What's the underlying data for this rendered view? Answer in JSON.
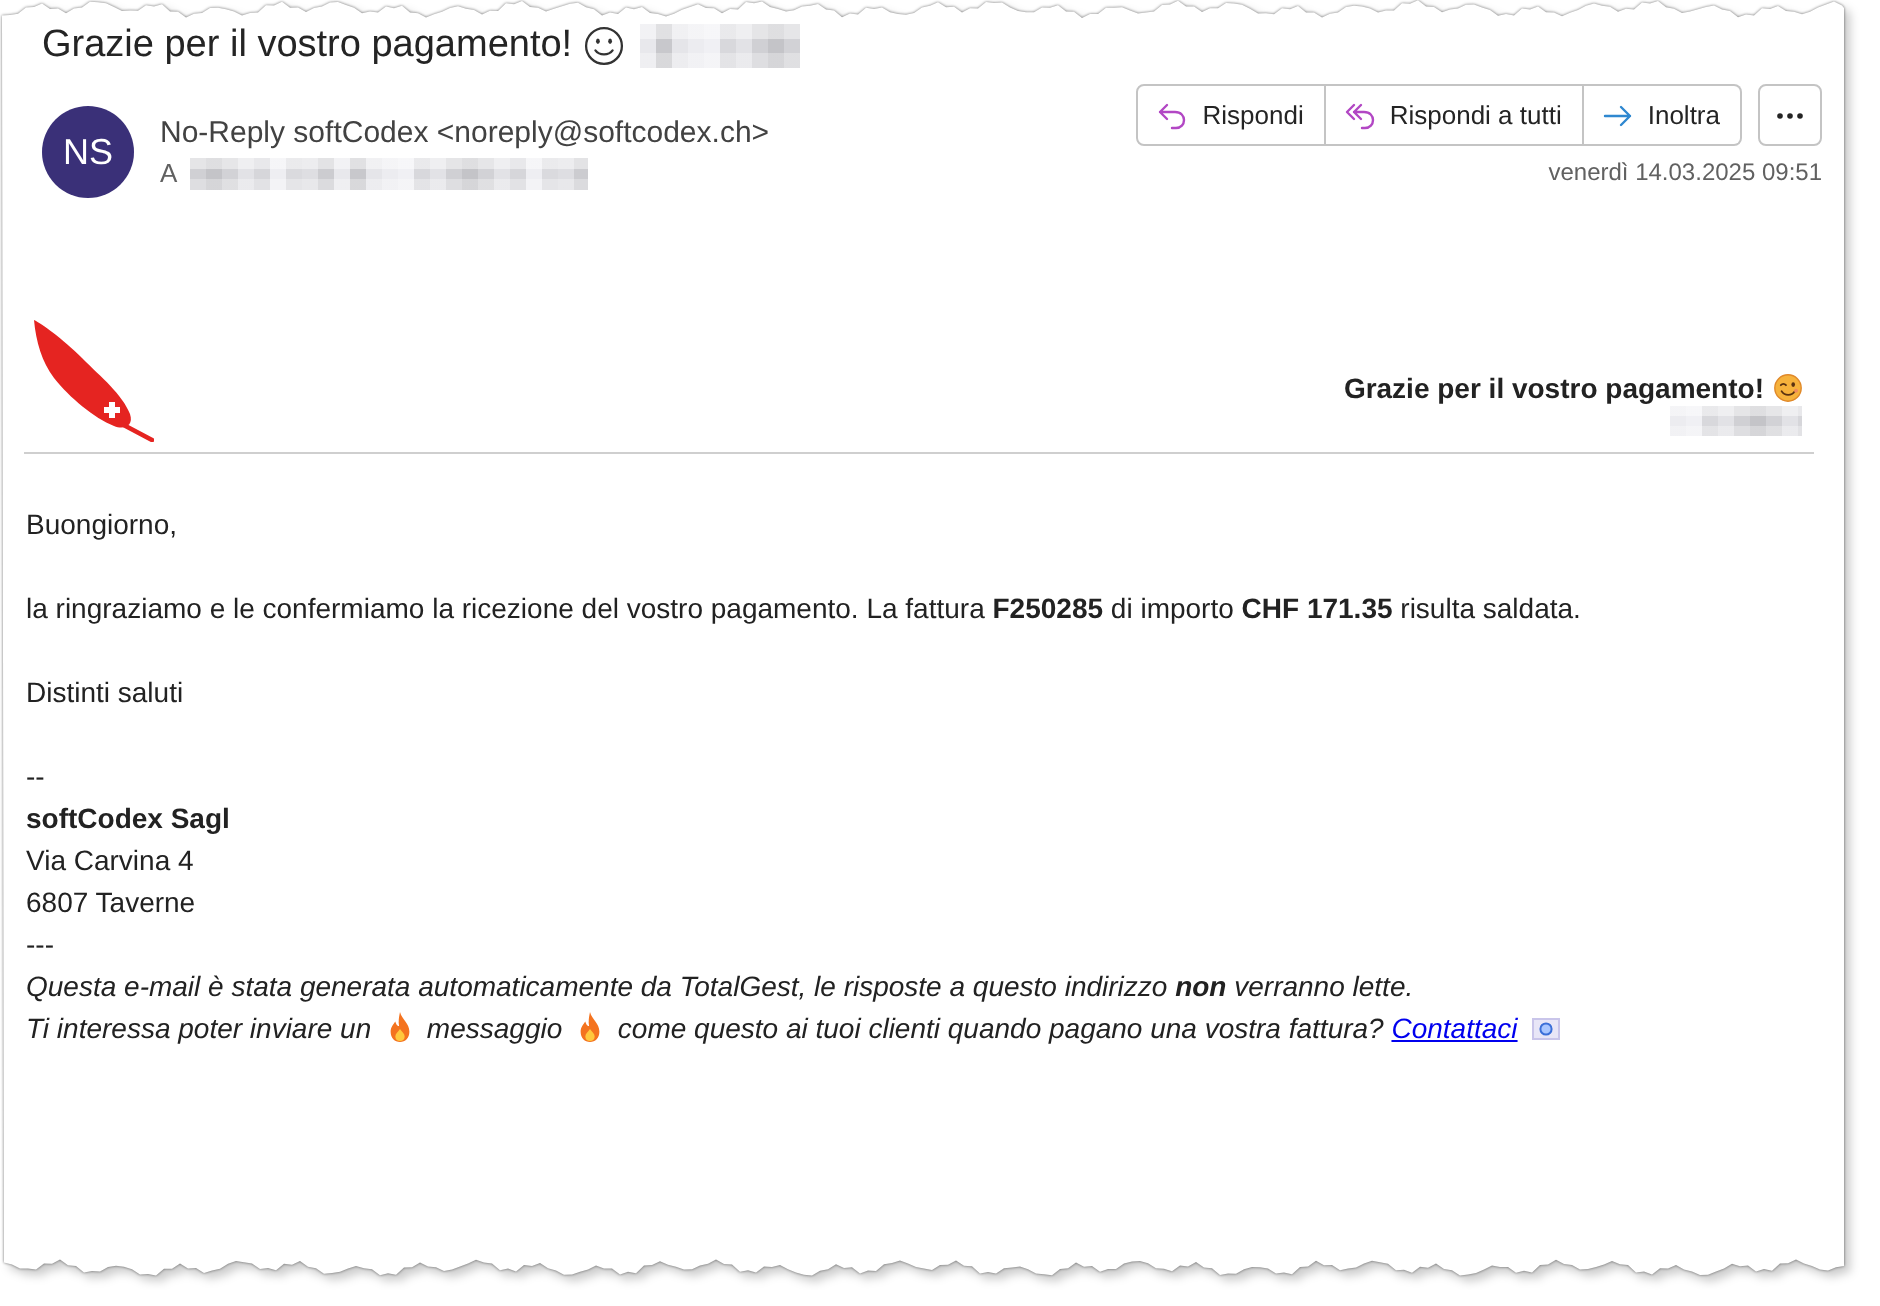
{
  "subject": {
    "text": "Grazie per il vostro pagamento!",
    "redacted_suffix": true
  },
  "sender": {
    "initials": "NS",
    "address": "No-Reply softCodex <noreply@softcodex.ch>"
  },
  "recipient": {
    "label": "A",
    "redacted": true
  },
  "actions": [
    {
      "kind": "reply",
      "label": "Rispondi"
    },
    {
      "kind": "reply_all",
      "label": "Rispondi a tutti"
    },
    {
      "kind": "forward",
      "label": "Inoltra"
    },
    {
      "kind": "more"
    }
  ],
  "sent_date": "venerdì 14.03.2025 09:51",
  "body": {
    "banner": {
      "heading": "Grazie per il vostro pagamento!",
      "redacted_suffix": true
    },
    "greeting": "Buongiorno,",
    "message": "la ringraziamo e le confermiamo la ricezione del vostro pagamento. La fattura **F250285** di importo **CHF 171.35** risulta saldata.",
    "closing": "Distinti saluti",
    "signature": {
      "separator": "--",
      "company": "softCodex Sagl",
      "address": [
        "Via Carvina 4",
        "6807 Taverne"
      ],
      "end_separator": "---"
    },
    "notice": "Questa e-mail è stata generata automaticamente da TotalGest, le risposte a questo indirizzo **non** verranno lette.",
    "promo": [
      {
        "kind": "text",
        "text": "Ti interessa poter inviare un"
      },
      {
        "kind": "flame"
      },
      {
        "kind": "text",
        "text": "messaggio"
      },
      {
        "kind": "flame"
      },
      {
        "kind": "text",
        "text": "come questo ai tuoi clienti quando pagano una vostra fattura?"
      },
      {
        "kind": "link",
        "text": "Contattaci"
      },
      {
        "kind": "badge_image"
      }
    ]
  }
}
